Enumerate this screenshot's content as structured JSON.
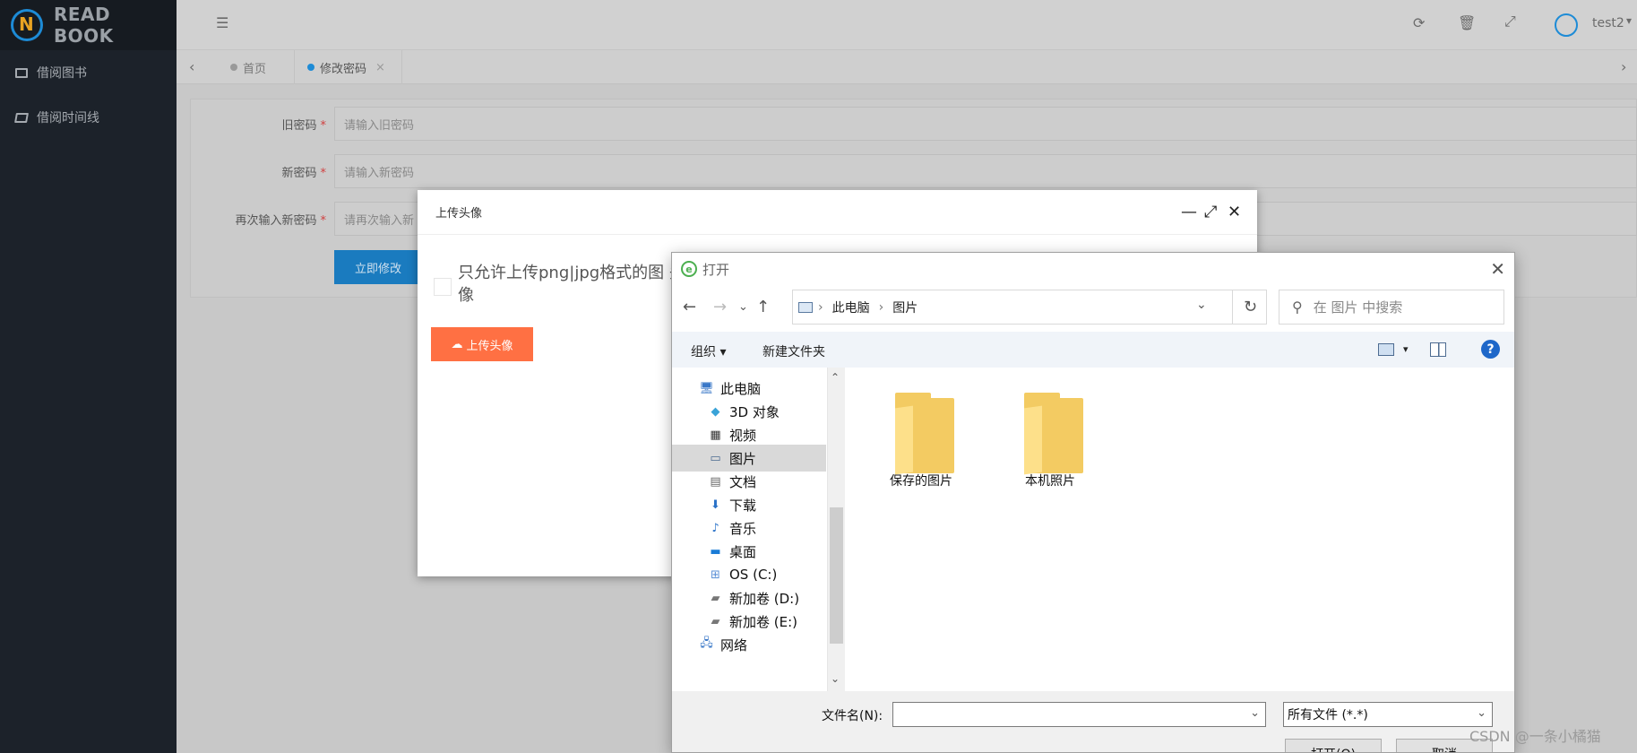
{
  "app": {
    "brand": "READ BOOK",
    "user": "test2",
    "sidebar": [
      {
        "label": "借阅图书"
      },
      {
        "label": "借阅时间线"
      }
    ],
    "tabs": [
      {
        "label": "首页"
      },
      {
        "label": "修改密码"
      }
    ],
    "form": {
      "old_label": "旧密码",
      "old_placeholder": "请输入旧密码",
      "new_label": "新密码",
      "new_placeholder": "请输入新密码",
      "again_label": "再次输入新密码",
      "again_placeholder": "请再次输入新",
      "required_mark": "*",
      "submit_label": "立即修改"
    }
  },
  "modal": {
    "title": "上传头像",
    "tip": "只允许上传png|jpg格式的图 头像",
    "upload_label": "上传头像"
  },
  "file_dialog": {
    "title": "打开",
    "path": [
      "此电脑",
      "图片"
    ],
    "search_placeholder": "在 图片 中搜索",
    "toolbar": {
      "organize": "组织 ▾",
      "new_folder": "新建文件夹"
    },
    "tree": [
      {
        "label": "此电脑",
        "icon": "computer-icon"
      },
      {
        "label": "3D 对象",
        "icon": "cube-icon"
      },
      {
        "label": "视频",
        "icon": "video-icon"
      },
      {
        "label": "图片",
        "icon": "picture-icon",
        "selected": true
      },
      {
        "label": "文档",
        "icon": "document-icon"
      },
      {
        "label": "下载",
        "icon": "download-icon"
      },
      {
        "label": "音乐",
        "icon": "music-icon"
      },
      {
        "label": "桌面",
        "icon": "desktop-icon"
      },
      {
        "label": "OS (C:)",
        "icon": "drive-icon"
      },
      {
        "label": "新加卷 (D:)",
        "icon": "drive-icon"
      },
      {
        "label": "新加卷 (E:)",
        "icon": "drive-icon"
      },
      {
        "label": "网络",
        "icon": "network-icon"
      }
    ],
    "folders": [
      {
        "name": "保存的图片"
      },
      {
        "name": "本机照片"
      }
    ],
    "filename_label": "文件名(N):",
    "filename_value": "",
    "filetype": "所有文件 (*.*)",
    "open_label": "打开(O)",
    "cancel_label": "取消"
  },
  "watermark": "CSDN @一条小橘猫",
  "colors": {
    "accent": "#1d8bd6",
    "upload": "#ff7043",
    "sidebar": "#1c222a"
  }
}
